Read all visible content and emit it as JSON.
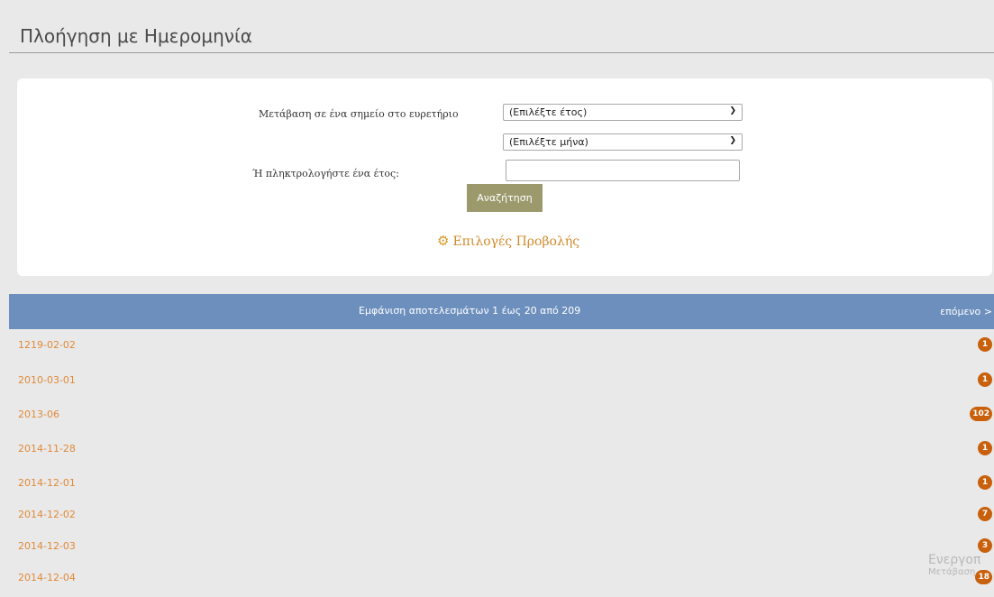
{
  "page": {
    "title": "Πλοήγηση με Ημερομηνία"
  },
  "form": {
    "jump_label": "Μετάβαση σε ένα σημείο στο ευρετήριο",
    "year_select_value": "(Επιλέξτε έτος)",
    "month_select_value": "(Επιλέξτε μήνα)",
    "year_input_label": "Ή πληκτρολογήστε ένα έτος:",
    "year_input_value": "",
    "search_button": "Αναζήτηση",
    "view_options": "Επιλογές Προβολής"
  },
  "results": {
    "summary": "Εμφάνιση αποτελεσμάτων 1 έως 20 από 209",
    "next_link": "επόμενο >",
    "rows": [
      {
        "date": "1219-02-02",
        "count": "1"
      },
      {
        "date": "2010-03-01",
        "count": "1"
      },
      {
        "date": "2013-06",
        "count": "102"
      },
      {
        "date": "2014-11-28",
        "count": "1"
      },
      {
        "date": "2014-12-01",
        "count": "1"
      },
      {
        "date": "2014-12-02",
        "count": "7"
      },
      {
        "date": "2014-12-03",
        "count": "3"
      },
      {
        "date": "2014-12-04",
        "count": "18"
      }
    ]
  },
  "watermark": {
    "line1": "Ενεργοπ",
    "line2": "Μετάβαση"
  },
  "colors": {
    "results_bar": "#6d8fbd",
    "link": "#e08a3a",
    "badge": "#c8600c",
    "button": "#9c9a6d"
  },
  "icons": {
    "view_options": "gear-icon",
    "select_arrow": "chevron-down-icon"
  }
}
